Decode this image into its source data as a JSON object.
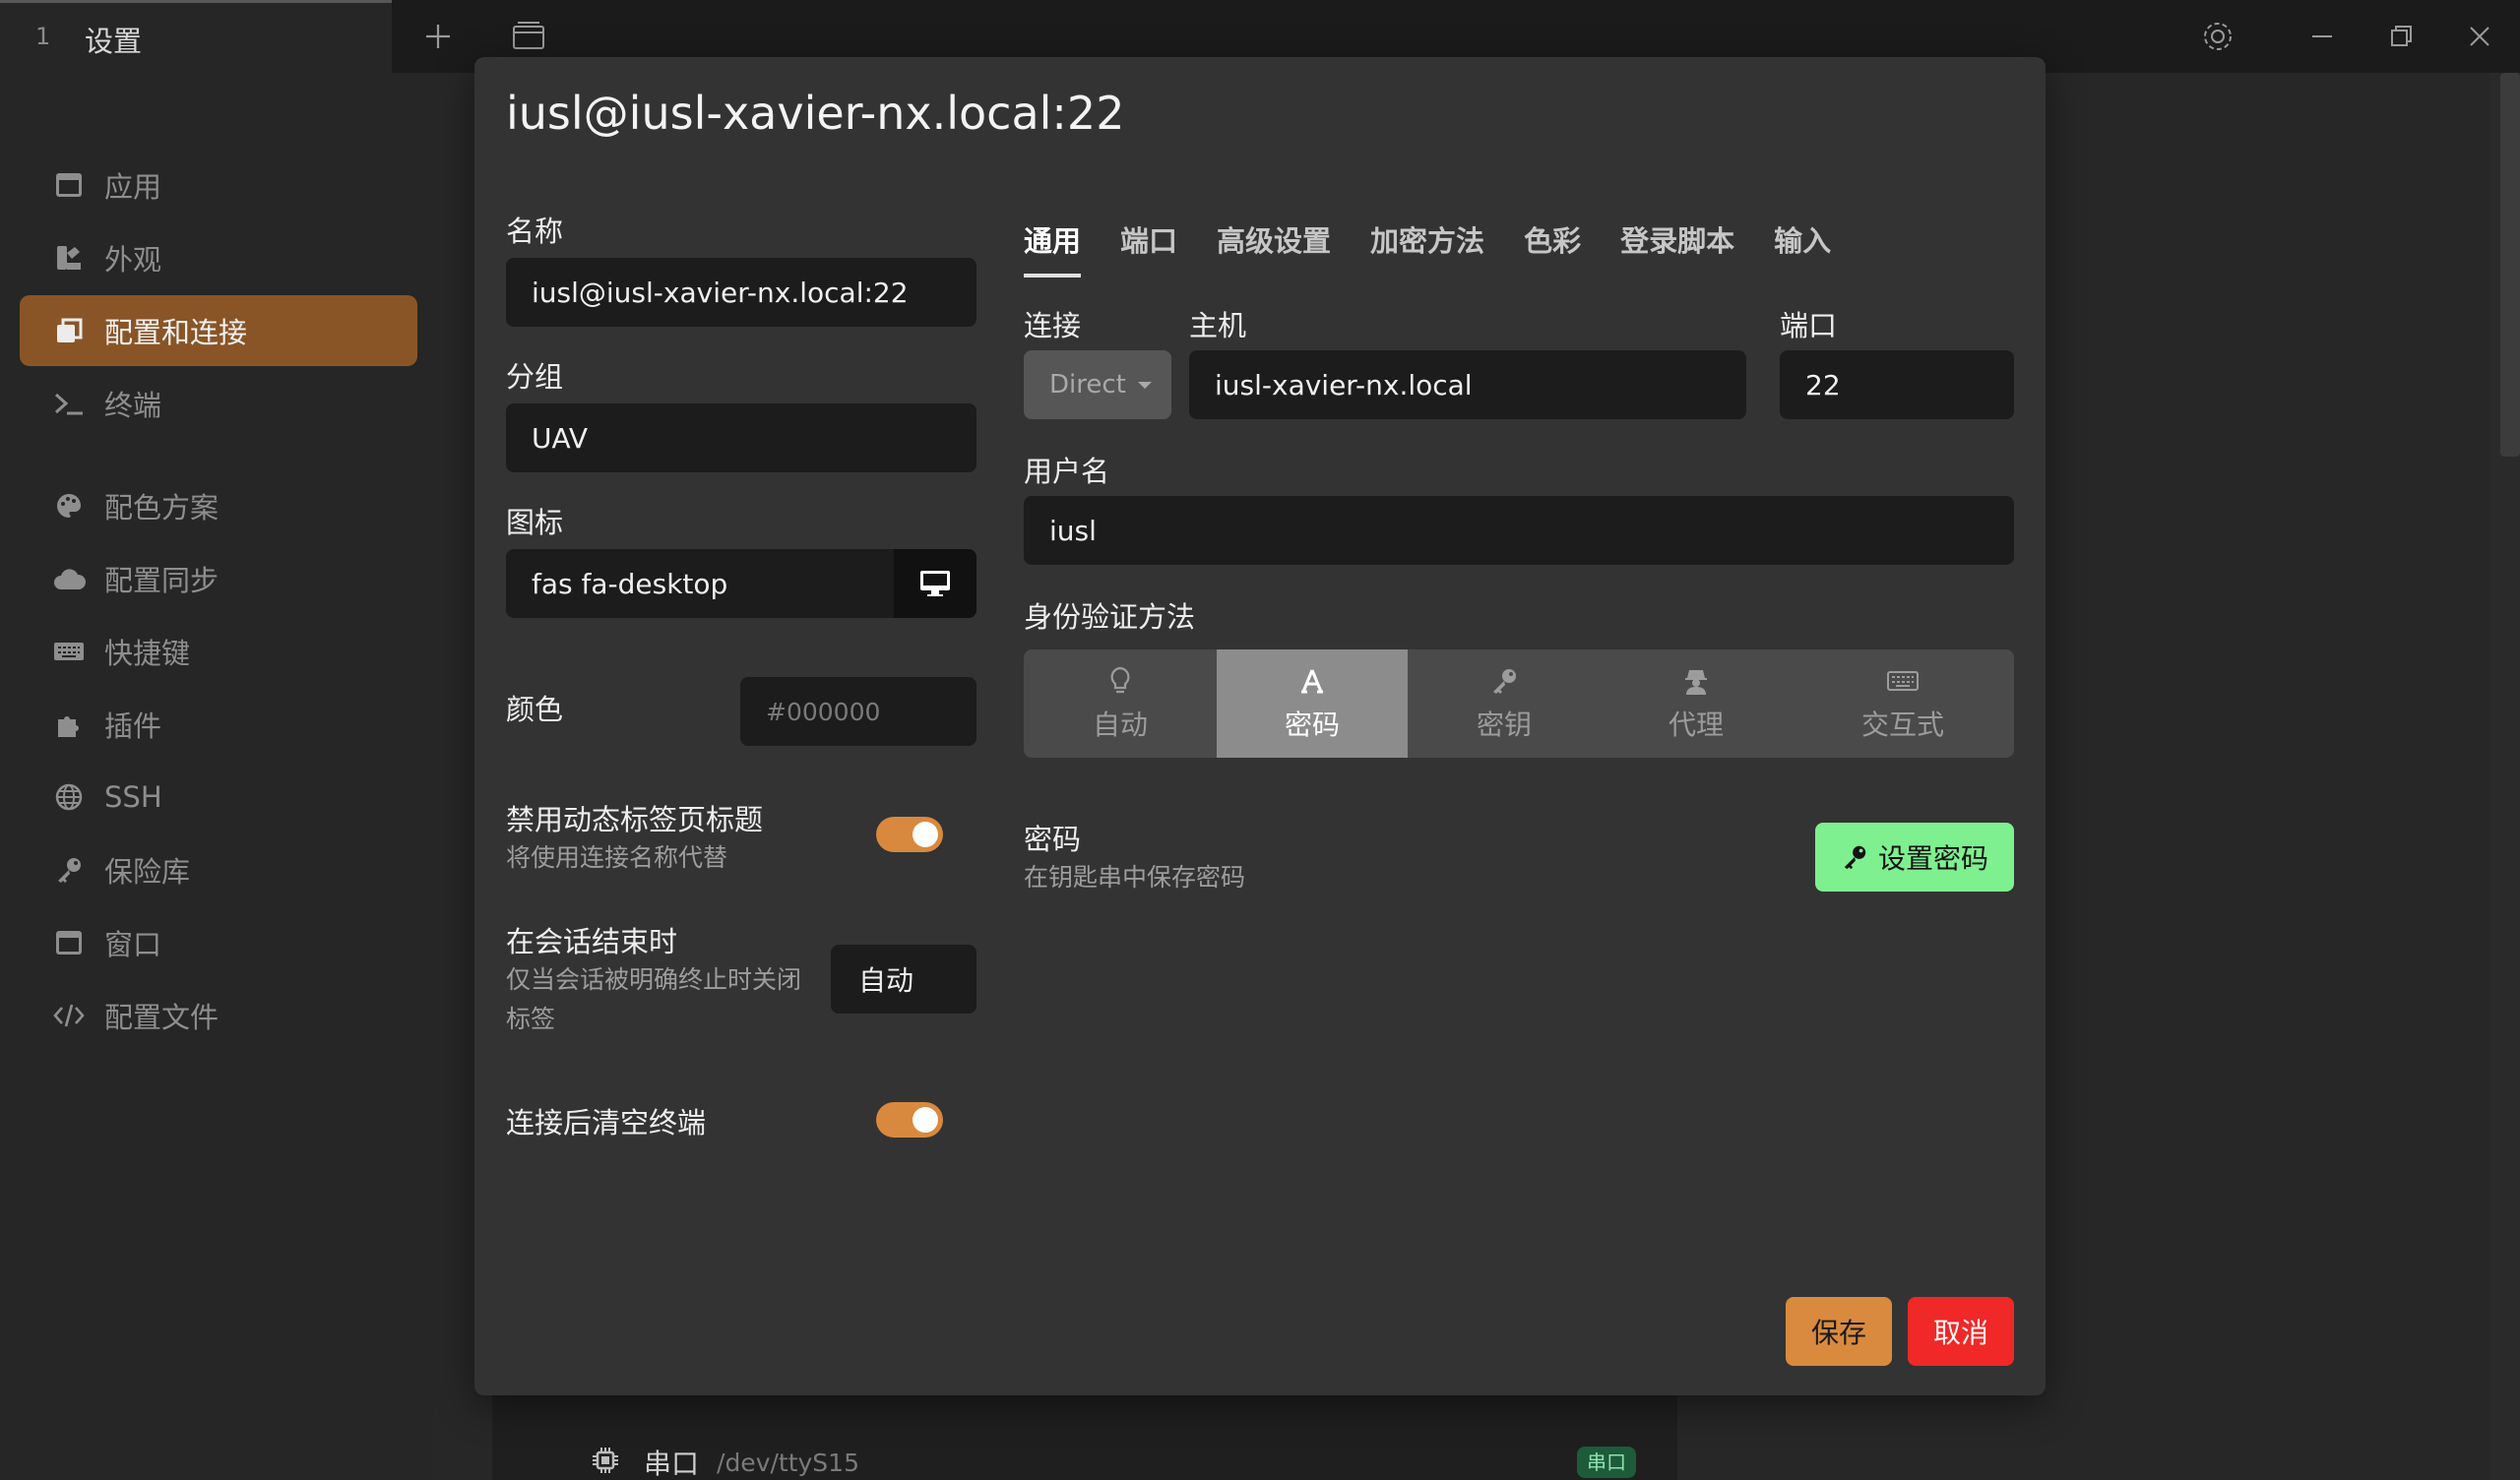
{
  "window": {
    "tab_number": "1",
    "tab_title": "设置"
  },
  "sidebar": {
    "items": [
      {
        "label": "应用",
        "icon": "window-icon"
      },
      {
        "label": "外观",
        "icon": "palette-brush-icon"
      },
      {
        "label": "配置和连接",
        "icon": "window-restore-icon",
        "active": true
      },
      {
        "label": "终端",
        "icon": "terminal-icon"
      },
      {
        "label": "配色方案",
        "icon": "palette-icon"
      },
      {
        "label": "配置同步",
        "icon": "cloud-icon"
      },
      {
        "label": "快捷键",
        "icon": "keyboard-icon"
      },
      {
        "label": "插件",
        "icon": "puzzle-icon"
      },
      {
        "label": "SSH",
        "icon": "globe-icon"
      },
      {
        "label": "保险库",
        "icon": "key-icon"
      },
      {
        "label": "窗口",
        "icon": "window-icon"
      },
      {
        "label": "配置文件",
        "icon": "code-icon"
      }
    ]
  },
  "background": {
    "serial_name": "串口",
    "serial_path": "/dev/ttyS15",
    "serial_badge": "串口"
  },
  "modal": {
    "title": "iusl@iusl-xavier-nx.local:22",
    "left": {
      "name_label": "名称",
      "name_value": "iusl@iusl-xavier-nx.local:22",
      "group_label": "分组",
      "group_value": "UAV",
      "icon_label": "图标",
      "icon_value": "fas fa-desktop",
      "color_label": "颜色",
      "color_placeholder": "#000000",
      "disable_dynamic_title_label": "禁用动态标签页标题",
      "disable_dynamic_title_desc": "将使用连接名称代替",
      "disable_dynamic_title_on": true,
      "on_session_end_label": "在会话结束时",
      "on_session_end_desc_1": "仅当会话被明确终止时关闭",
      "on_session_end_desc_2": "标签",
      "on_session_end_value": "自动",
      "clear_after_connect_label": "连接后清空终端",
      "clear_after_connect_on": true
    },
    "tabs": [
      "通用",
      "端口",
      "高级设置",
      "加密方法",
      "色彩",
      "登录脚本",
      "输入"
    ],
    "active_tab": "通用",
    "general": {
      "connection_label": "连接",
      "connection_value": "Direct",
      "host_label": "主机",
      "host_value": "iusl-xavier-nx.local",
      "port_label": "端口",
      "port_value": "22",
      "username_label": "用户名",
      "username_value": "iusl",
      "auth_label": "身份验证方法",
      "auth_methods": [
        {
          "label": "自动",
          "icon": "lightbulb-icon"
        },
        {
          "label": "密码",
          "icon": "font-a-icon",
          "active": true
        },
        {
          "label": "密钥",
          "icon": "key-icon"
        },
        {
          "label": "代理",
          "icon": "user-secret-icon"
        },
        {
          "label": "交互式",
          "icon": "keyboard-icon"
        }
      ],
      "password_label": "密码",
      "password_desc": "在钥匙串中保存密码",
      "set_password_button": "设置密码"
    },
    "save_button": "保存",
    "cancel_button": "取消"
  },
  "colors": {
    "accent": "#d9893e",
    "sidebar_active": "#8a5526",
    "set_password": "#7ef08f",
    "cancel": "#f02828"
  }
}
